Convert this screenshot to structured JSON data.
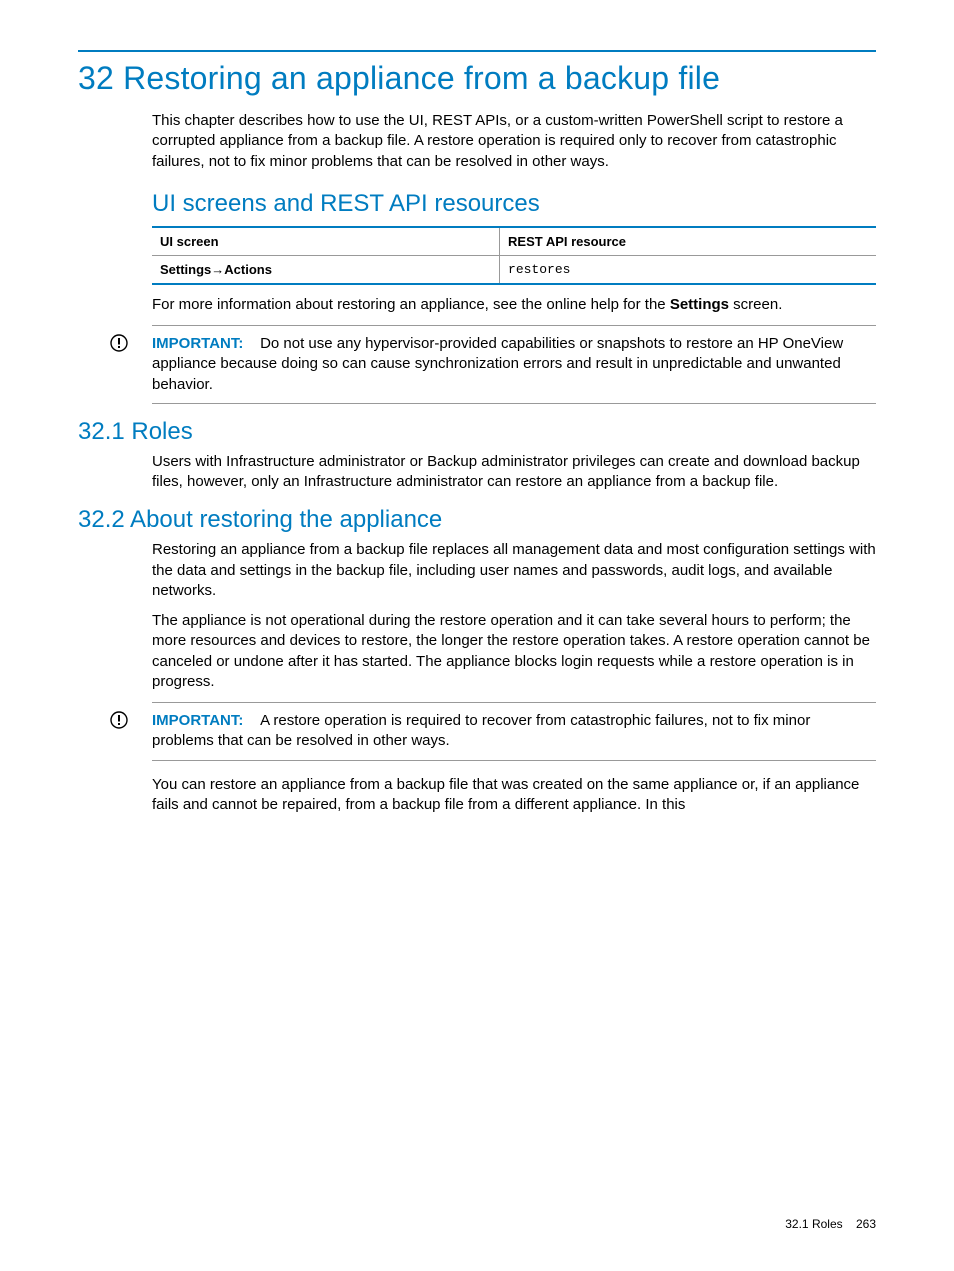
{
  "chapter": {
    "title": "32 Restoring an appliance from a backup file",
    "intro": "This chapter describes how to use the UI, REST APIs, or a custom-written PowerShell script to restore a corrupted appliance from a backup file. A restore operation is required only to recover from catastrophic failures, not to fix minor problems that can be resolved in other ways."
  },
  "ui_rest": {
    "heading": "UI screens and REST API resources",
    "headers": {
      "ui": "UI screen",
      "api": "REST API resource"
    },
    "row": {
      "ui_prefix": "Settings",
      "ui_arrow": "→",
      "ui_suffix": "Actions",
      "api": "restores"
    },
    "more_info_pre": "For more information about restoring an appliance, see the online help for the ",
    "more_info_bold": "Settings",
    "more_info_post": " screen."
  },
  "important1": {
    "label": "IMPORTANT:",
    "text": "Do not use any hypervisor-provided capabilities or snapshots to restore an HP OneView appliance because doing so can cause synchronization errors and result in unpredictable and unwanted behavior."
  },
  "roles": {
    "heading": "32.1 Roles",
    "text": "Users with Infrastructure administrator or Backup administrator privileges can create and download backup files, however, only an Infrastructure administrator can restore an appliance from a backup file."
  },
  "about": {
    "heading": "32.2 About restoring the appliance",
    "p1": "Restoring an appliance from a backup file replaces all management data and most configuration settings with the data and settings in the backup file, including user names and passwords, audit logs, and available networks.",
    "p2": "The appliance is not operational during the restore operation and it can take several hours to perform; the more resources and devices to restore, the longer the restore operation takes. A restore operation cannot be canceled or undone after it has started. The appliance blocks login requests while a restore operation is in progress."
  },
  "important2": {
    "label": "IMPORTANT:",
    "text": "A restore operation is required to recover from catastrophic failures, not to fix minor problems that can be resolved in other ways."
  },
  "after": {
    "p": "You can restore an appliance from a backup file that was created on the same appliance or, if an appliance fails and cannot be repaired, from a backup file from a different appliance. In this"
  },
  "footer": {
    "section": "32.1 Roles",
    "page": "263"
  }
}
